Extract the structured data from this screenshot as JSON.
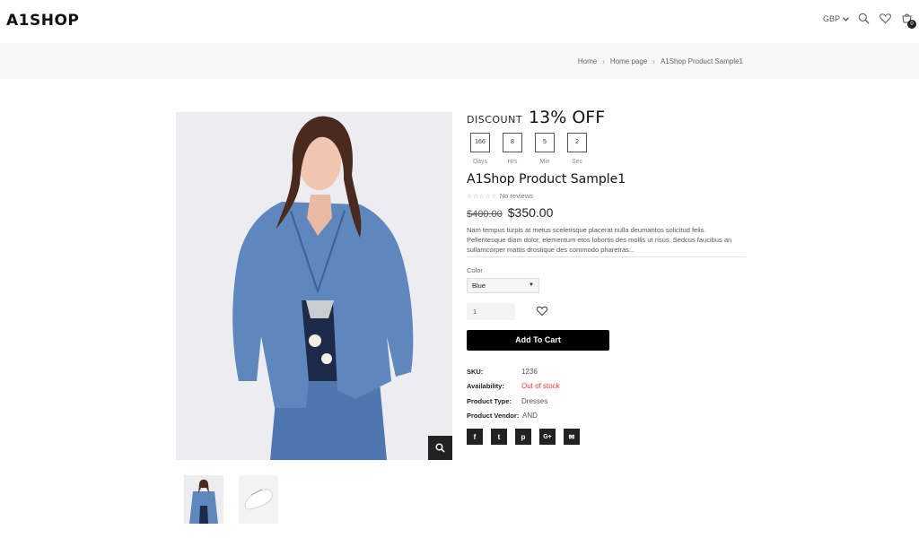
{
  "header": {
    "logo": "A1SHOP",
    "currency": "GBP",
    "cart_count": "0"
  },
  "breadcrumb": {
    "items": [
      "Home",
      "Home page",
      "A1Shop Product Sample1"
    ]
  },
  "product": {
    "discount_label": "DISCOUNT",
    "discount_value": "13% OFF",
    "countdown": [
      {
        "value": "166",
        "label": "Days"
      },
      {
        "value": "8",
        "label": "Hrs"
      },
      {
        "value": "5",
        "label": "Min"
      },
      {
        "value": "2",
        "label": "Sec"
      }
    ],
    "title": "A1Shop Product Sample1",
    "reviews": "No reviews",
    "old_price": "$400.00",
    "price": "$350.00",
    "description": "Nam tempus turpis at metus scelerisque placerat nulla deumantos solicitud felis. Pellentesque diam dolor, elementum etos lobortis des mollis ut risus. Sedcus faucibus an sullamcorper mattis drostique des commodo pharetras...",
    "color_label": "Color",
    "color_value": "Blue",
    "quantity": "1",
    "add_to_cart": "Add To Cart",
    "meta": {
      "sku_label": "SKU:",
      "sku": "1236",
      "availability_label": "Availability:",
      "availability": "Out of stock",
      "type_label": "Product Type:",
      "type": "Dresses",
      "vendor_label": "Product Vendor:",
      "vendor": "AND"
    },
    "social": [
      {
        "icon": "facebook-icon",
        "glyph": "f"
      },
      {
        "icon": "twitter-icon",
        "glyph": "t"
      },
      {
        "icon": "pinterest-icon",
        "glyph": "p"
      },
      {
        "icon": "google-plus-icon",
        "glyph": "G+"
      },
      {
        "icon": "email-icon",
        "glyph": "✉"
      }
    ]
  },
  "colors": {
    "accent": "#000000",
    "out_of_stock": "#ee3333"
  }
}
